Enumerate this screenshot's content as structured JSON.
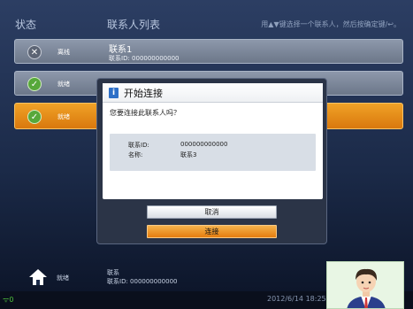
{
  "header": {
    "status_col": "状态",
    "list_title": "联系人列表",
    "hint": "用▲▼键选择一个联系人，然后按确定键/↩。"
  },
  "contacts": [
    {
      "status": "离线",
      "status_icon": "x-icon",
      "name": "联系1",
      "id": "联系ID: 000000000000"
    },
    {
      "status": "就绪",
      "status_icon": "checkmark-icon",
      "name": "",
      "id": ""
    },
    {
      "status": "就绪",
      "status_icon": "checkmark-icon",
      "name": "",
      "id": ""
    }
  ],
  "dialog": {
    "title": "开始连接",
    "question": "您要连接此联系人吗？",
    "id_label": "联系ID:",
    "id_value": "000000000000",
    "name_label": "名称:",
    "name_value": "联系3",
    "cancel_label": "取消",
    "connect_label": "连接"
  },
  "footer": {
    "status": "就绪",
    "contact_name": "联系",
    "contact_id": "联系ID: 000000000000"
  },
  "statusbar": {
    "wifi_label": "0",
    "datetime": "2012/6/14 18:25"
  },
  "colors": {
    "accent_orange": "#e57d0f",
    "ready_green": "#57a83a",
    "background": "#1b2a48"
  }
}
